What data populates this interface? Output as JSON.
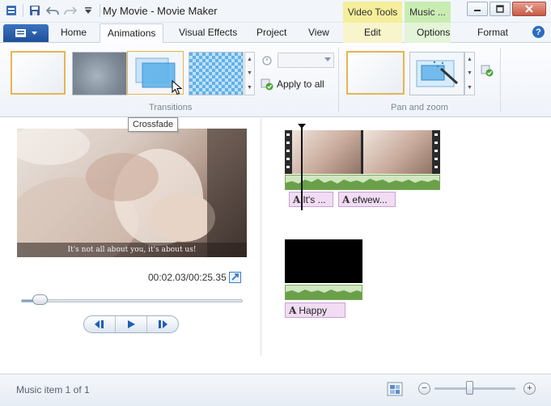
{
  "window": {
    "title": "My Movie - Movie Maker",
    "context_tabs": {
      "video_tools": "Video Tools",
      "music_tools": "Music ..."
    }
  },
  "qat": {
    "icons": [
      "save-icon",
      "undo-icon",
      "redo-icon",
      "qat-dropdown-icon"
    ]
  },
  "ribbon_tabs": {
    "home": "Home",
    "animations": "Animations",
    "visual_effects": "Visual Effects",
    "project": "Project",
    "view": "View",
    "edit": "Edit",
    "options": "Options",
    "format": "Format",
    "active": "Animations"
  },
  "ribbon": {
    "transitions_label": "Transitions",
    "pan_zoom_label": "Pan and zoom",
    "apply_to_all": "Apply to all",
    "duration_value": "",
    "hovered_transition": "Crossfade"
  },
  "preview": {
    "caption_text": "It's not all about you, it's about us!",
    "timecode": "00:02.03/00:25.35",
    "seek_progress": 0.08
  },
  "storyboard": {
    "clip1_captions": [
      "It's ...",
      "efwew..."
    ],
    "clip2_caption": "Happy"
  },
  "status": {
    "text": "Music item 1 of 1",
    "zoom_out": "−",
    "zoom_in": "+"
  },
  "colors": {
    "accent": "#2b6cc4",
    "selected_border": "#e8b354",
    "video_tools_tab": "#f5ee9b",
    "music_tools_tab": "#c9ecb3",
    "caption_chip": "#f1dcf3",
    "waveform": "#7aa85a"
  }
}
